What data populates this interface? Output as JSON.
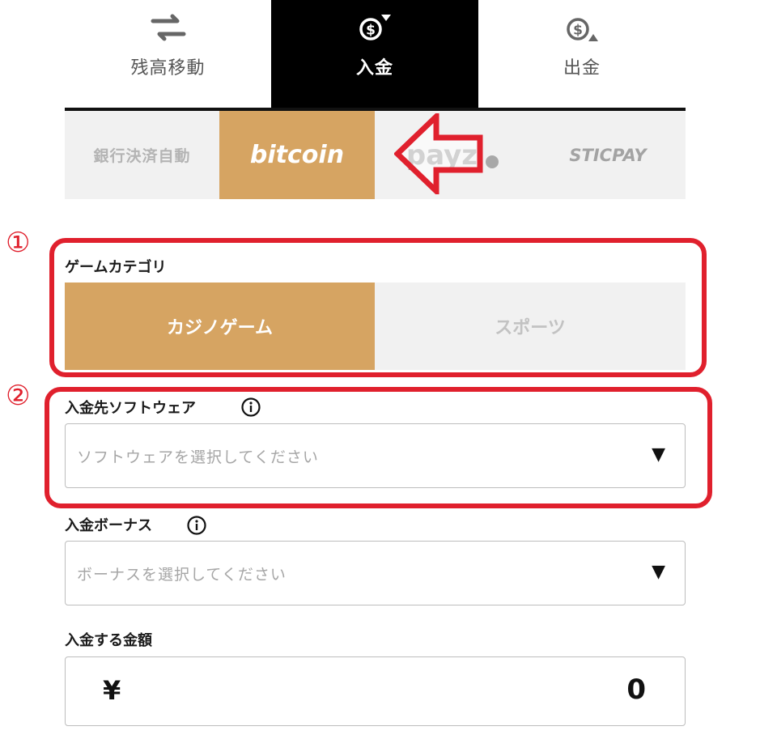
{
  "top_tabs": {
    "transfer": "残高移動",
    "deposit": "入金",
    "withdraw": "出金"
  },
  "payment_methods": {
    "bank": "銀行決済自動",
    "bitcoin": "bitcoin",
    "payz": "payz",
    "sticpay": "STICPAY"
  },
  "annotations": {
    "step1": "①",
    "step2": "②"
  },
  "game_category": {
    "label": "ゲームカテゴリ",
    "options": [
      "カジノゲーム",
      "スポーツ"
    ]
  },
  "software": {
    "label": "入金先ソフトウェア",
    "placeholder": "ソフトウェアを選択してください",
    "caret": "▼"
  },
  "bonus": {
    "label": "入金ボーナス",
    "placeholder": "ボーナスを選択してください",
    "caret": "▼"
  },
  "amount": {
    "label": "入金する金額",
    "currency": "¥",
    "value": "0"
  },
  "colors": {
    "accent": "#d6a462",
    "annotation_red": "#e0202d",
    "active_tab_bg": "#000000"
  }
}
